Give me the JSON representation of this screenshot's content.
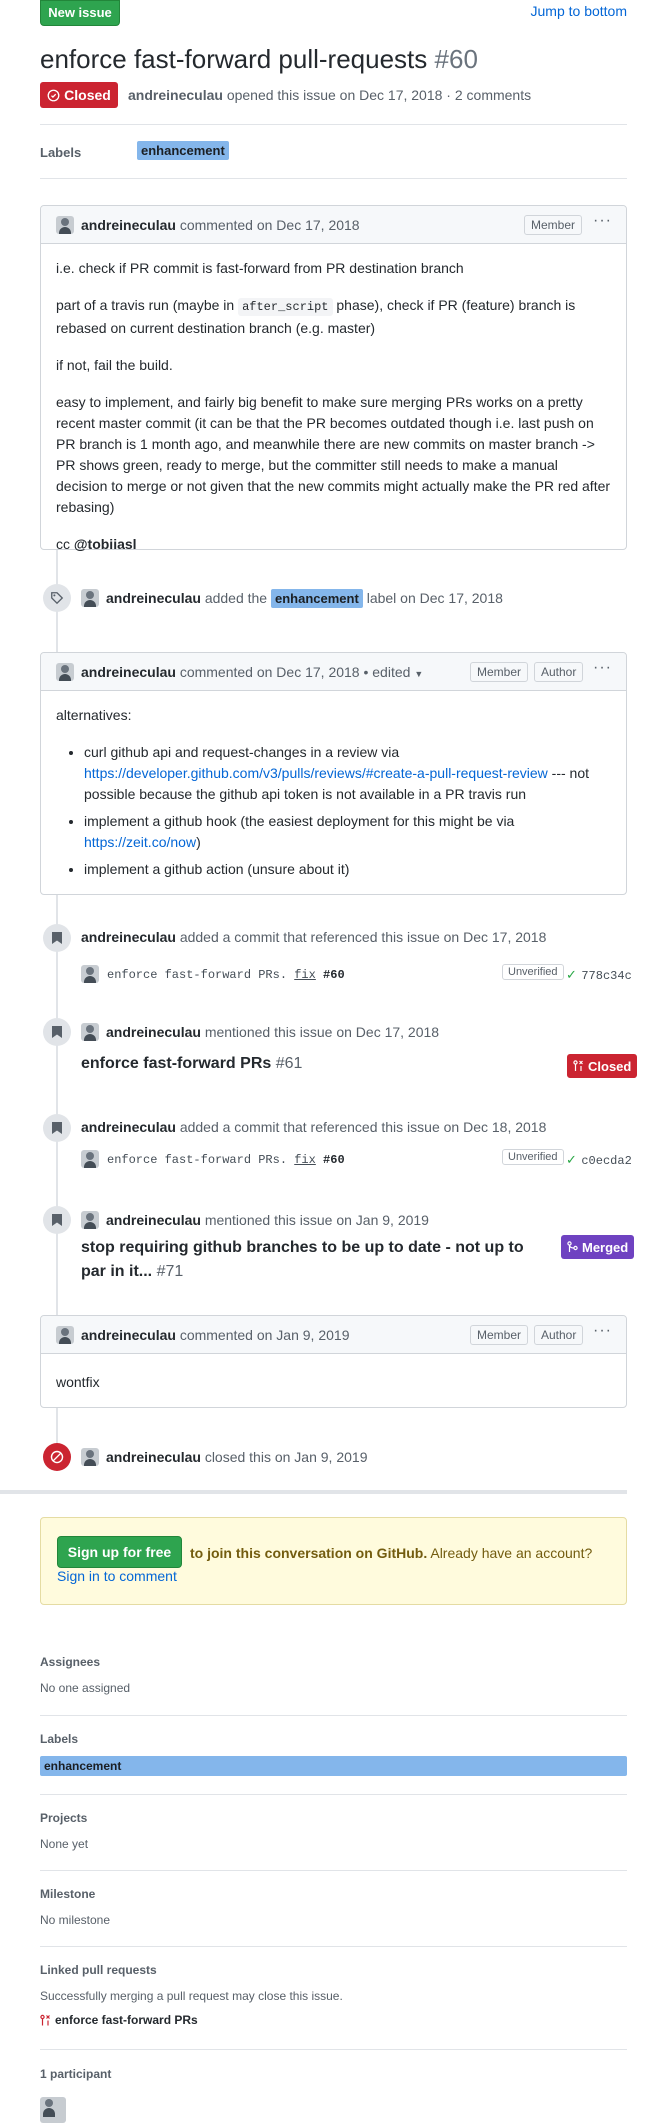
{
  "header": {
    "new_issue": "New issue",
    "jump_to_bottom": "Jump to bottom",
    "title": "enforce fast-forward pull-requests",
    "number": "#60",
    "state": "Closed",
    "author": "andreineculau",
    "meta": "opened this issue on Dec 17, 2018 · 2 comments"
  },
  "labels_row": {
    "title": "Labels",
    "label": "enhancement"
  },
  "comment1": {
    "author": "andreineculau",
    "date": "commented on Dec 17, 2018",
    "badge": "Member",
    "p1": "i.e. check if PR commit is fast-forward from PR destination branch",
    "p2a": "part of a travis run (maybe in ",
    "p2code": "after_script",
    "p2b": " phase), check if PR (feature) branch is rebased on current destination branch (e.g. master)",
    "p3": "if not, fail the build.",
    "p4": "easy to implement, and fairly big benefit to make sure merging PRs works on a pretty recent master commit (it can be that the PR becomes outdated though i.e. last push on PR branch is 1 month ago, and meanwhile there are new commits on master branch -> PR shows green, ready to merge, but the committer still needs to make a manual decision to merge or not given that the new commits might actually make the PR red after rebasing)",
    "p5a": "cc ",
    "p5mention": "@tobiiasl"
  },
  "event_label": {
    "author": "andreineculau",
    "text_a": "added the",
    "label": "enhancement",
    "text_b": "label on Dec 17, 2018"
  },
  "comment2": {
    "author": "andreineculau",
    "date": "commented on Dec 17, 2018",
    "edited": "• edited",
    "badge_member": "Member",
    "badge_author": "Author",
    "intro": "alternatives:",
    "li1_a": "curl github api and request-changes in a review via ",
    "li1_link": "https://developer.github.com/v3/pulls/reviews/#create-a-pull-request-review",
    "li1_b": " --- not possible because the github api token is not available in a PR travis run",
    "li2_a": "implement a github hook (the easiest deployment for this might be via ",
    "li2_link": "https://zeit.co/now",
    "li2_b": ")",
    "li3": "implement a github action (unsure about it)"
  },
  "event_commit1": {
    "author": "andreineculau",
    "text": "added a commit that referenced this issue on Dec 17, 2018",
    "msg_a": "enforce fast-forward PRs. ",
    "msg_fix": "fix",
    "msg_ref": "#60",
    "verify": "Unverified",
    "sha": "778c34c"
  },
  "event_mention1": {
    "author": "andreineculau",
    "text": "mentioned this issue on Dec 17, 2018",
    "pr_title": "enforce fast-forward PRs",
    "pr_num": "#61",
    "state": "Closed"
  },
  "event_commit2": {
    "author": "andreineculau",
    "text": "added a commit that referenced this issue on Dec 18, 2018",
    "msg_a": "enforce fast-forward PRs. ",
    "msg_fix": "fix",
    "msg_ref": "#60",
    "verify": "Unverified",
    "sha": "c0ecda2"
  },
  "event_mention2": {
    "author": "andreineculau",
    "text": "mentioned this issue on Jan 9, 2019",
    "pr_title": "stop requiring github branches to be up to date - not up to par in it...",
    "pr_num": "#71",
    "state": "Merged"
  },
  "comment3": {
    "author": "andreineculau",
    "date": "commented on Jan 9, 2019",
    "badge_member": "Member",
    "badge_author": "Author",
    "body": "wontfix"
  },
  "event_closed": {
    "author": "andreineculau",
    "text": "closed this on Jan 9, 2019"
  },
  "signup": {
    "button": "Sign up for free",
    "text": "to join this conversation on GitHub.",
    "already": " Already have an account? ",
    "signin": "Sign in to comment"
  },
  "sidebar": {
    "assignees_title": "Assignees",
    "assignees_value": "No one assigned",
    "labels_title": "Labels",
    "labels_value": "enhancement",
    "projects_title": "Projects",
    "projects_value": "None yet",
    "milestone_title": "Milestone",
    "milestone_value": "No milestone",
    "linked_title": "Linked pull requests",
    "linked_desc": "Successfully merging a pull request may close this issue.",
    "linked_pr": "enforce fast-forward PRs",
    "participants_title": "1 participant"
  },
  "colors": {
    "green": "#2ea44f",
    "red": "#cb2431",
    "purple": "#6f42c1",
    "label_blue": "#84b6eb",
    "link": "#0366d6"
  }
}
